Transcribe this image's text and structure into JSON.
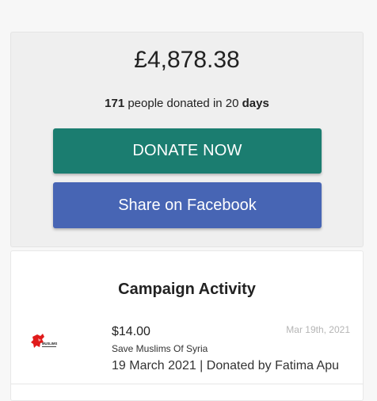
{
  "donation": {
    "amount": "£4,878.38",
    "count": "171",
    "summary_middle": " people donated in 20 ",
    "days_label": "days"
  },
  "buttons": {
    "donate_label": "DONATE NOW",
    "share_label": "Share on Facebook"
  },
  "colors": {
    "donate": "#1b7d70",
    "share": "#4765b4"
  },
  "activity": {
    "title": "Campaign Activity",
    "items": [
      {
        "amount": "$14.00",
        "date_short": "Mar 19th, 2021",
        "campaign": "Save Muslims Of Syria",
        "meta": "19 March 2021 | Donated by Fatima Apu",
        "logo_text": "MUSLIMS"
      }
    ]
  }
}
